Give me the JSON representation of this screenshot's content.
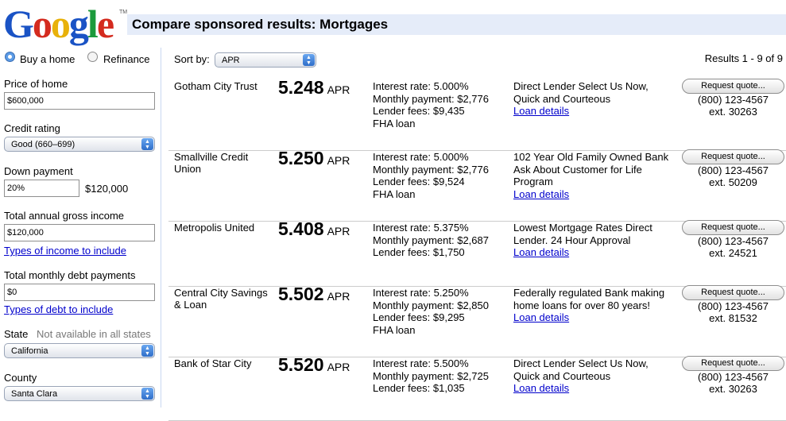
{
  "logo": {
    "letters": [
      "G",
      "o",
      "o",
      "g",
      "l",
      "e"
    ],
    "tm": "TM"
  },
  "header": {
    "title": "Compare sponsored results: Mortgages"
  },
  "sidebar": {
    "purpose": {
      "options": [
        "Buy a home",
        "Refinance"
      ],
      "selected": "Buy a home"
    },
    "price": {
      "label": "Price of home",
      "value": "$600,000"
    },
    "credit": {
      "label": "Credit rating",
      "value": "Good (660–699)"
    },
    "down": {
      "label": "Down payment",
      "value": "20%",
      "amount": "$120,000"
    },
    "income": {
      "label": "Total annual gross income",
      "value": "$120,000",
      "link": "Types of income to include"
    },
    "debt": {
      "label": "Total monthly debt payments",
      "value": "$0",
      "link": "Types of debt to include"
    },
    "state": {
      "label": "State",
      "note": "Not available in all states",
      "value": "California"
    },
    "county": {
      "label": "County",
      "value": "Santa Clara"
    }
  },
  "results": {
    "sort_label": "Sort by:",
    "sort_value": "APR",
    "count_text": "Results 1 - 9 of 9",
    "apr_unit": "APR",
    "button_label": "Request quote...",
    "link_label": "Loan details",
    "rows": [
      {
        "lender": "Gotham City Trust",
        "apr": "5.248",
        "details": [
          "Interest rate: 5.000%",
          "Monthly payment: $2,776",
          "Lender fees: $9,435",
          "FHA loan"
        ],
        "ad": "Direct Lender Select Us Now, Quick and Courteous",
        "phone": "(800) 123-4567",
        "ext": "ext. 30263"
      },
      {
        "lender": "Smallville Credit Union",
        "apr": "5.250",
        "details": [
          "Interest rate: 5.000%",
          "Monthly payment: $2,776",
          "Lender fees: $9,524",
          "FHA loan"
        ],
        "ad": "102 Year Old Family Owned Bank Ask About Customer for Life Program",
        "phone": "(800) 123-4567",
        "ext": "ext. 50209"
      },
      {
        "lender": "Metropolis United",
        "apr": "5.408",
        "details": [
          "Interest rate: 5.375%",
          "Monthly payment: $2,687",
          "Lender fees: $1,750"
        ],
        "ad": "Lowest Mortgage Rates Direct Lender. 24 Hour Approval",
        "phone": "(800) 123-4567",
        "ext": "ext. 24521"
      },
      {
        "lender": "Central City Savings & Loan",
        "apr": "5.502",
        "details": [
          "Interest rate: 5.250%",
          "Monthly payment: $2,850",
          "Lender fees: $9,295",
          "FHA loan"
        ],
        "ad": "Federally regulated Bank making home loans for over 80 years!",
        "phone": "(800) 123-4567",
        "ext": "ext. 81532"
      },
      {
        "lender": "Bank of Star City",
        "apr": "5.520",
        "details": [
          "Interest rate: 5.500%",
          "Monthly payment: $2,725",
          "Lender fees: $1,035"
        ],
        "ad": "Direct Lender Select Us Now, Quick and Courteous",
        "phone": "(800) 123-4567",
        "ext": "ext. 30263"
      }
    ]
  }
}
